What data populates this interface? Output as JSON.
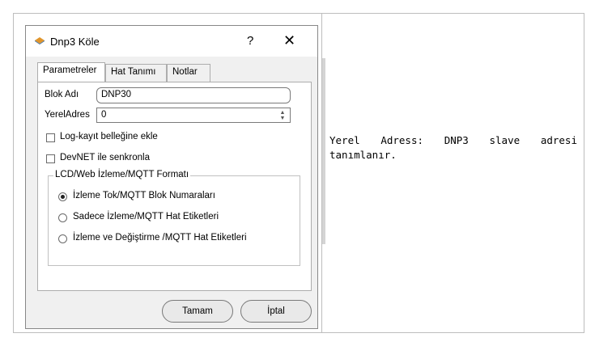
{
  "dialog": {
    "title": "Dnp3 Köle",
    "help": "?",
    "close": "✕",
    "tabs": [
      "Parametreler",
      "Hat Tanımı",
      "Notlar"
    ],
    "block_name_label": "Blok Adı",
    "block_name_value": "DNP30",
    "local_address_label": "YerelAdres",
    "local_address_value": "0",
    "check_log": "Log-kayıt belleğine ekle",
    "check_devnet": "DevNET ile senkronla",
    "group_title": "LCD/Web İzleme/MQTT Formatı",
    "radio_1": "İzleme Tok/MQTT Blok Numaraları",
    "radio_2": "Sadece İzleme/MQTT Hat Etiketleri",
    "radio_3": "İzleme ve Değiştirme /MQTT Hat Etiketleri",
    "ok_button": "Tamam",
    "cancel_button": "İptal"
  },
  "description": {
    "words_line1": [
      "Yerel",
      "Adress:",
      "DNP3",
      "slave",
      "adresi"
    ],
    "line2": "tanımlanır."
  }
}
